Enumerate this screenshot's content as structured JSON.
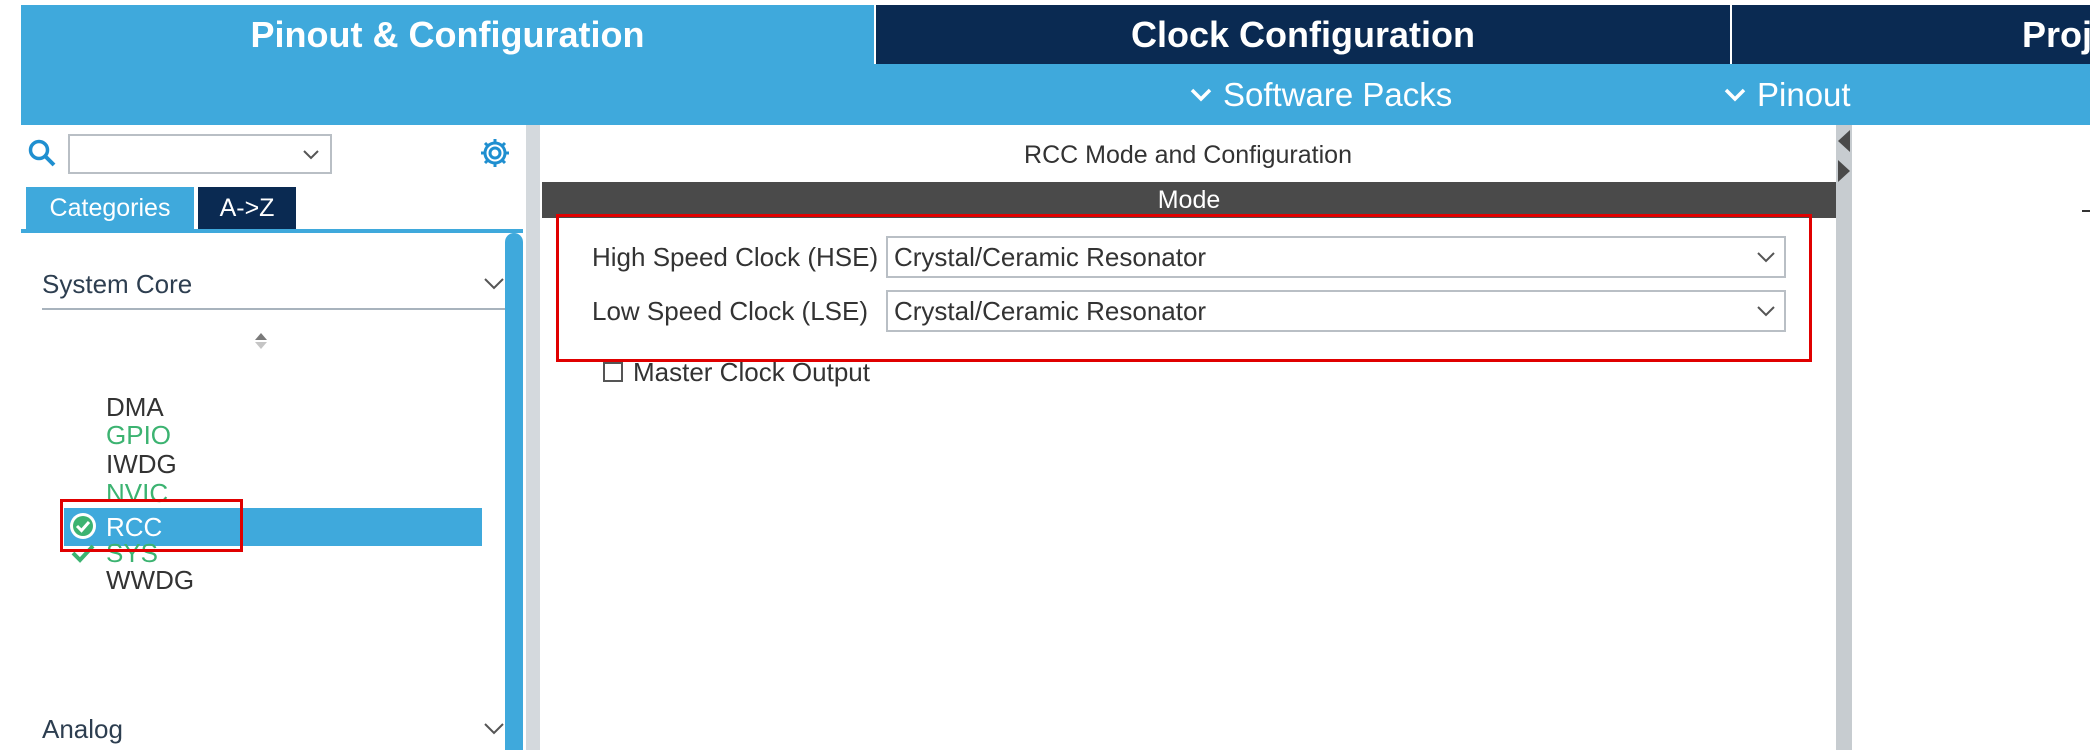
{
  "tabs": [
    {
      "label": "Pinout & Configuration",
      "active": true
    },
    {
      "label": "Clock Configuration",
      "active": false
    },
    {
      "label": "Proje",
      "active": false
    }
  ],
  "submenu": {
    "software_packs": "Software Packs",
    "pinout": "Pinout"
  },
  "left_panel": {
    "search": {
      "value": ""
    },
    "category_tabs": [
      "Categories",
      "A->Z"
    ],
    "groups": {
      "system_core": "System Core",
      "analog": "Analog"
    },
    "items": [
      {
        "label": "DMA",
        "status": "none"
      },
      {
        "label": "GPIO",
        "status": "green"
      },
      {
        "label": "IWDG",
        "status": "none"
      },
      {
        "label": "NVIC",
        "status": "green"
      },
      {
        "label": "RCC",
        "status": "selected-configured"
      },
      {
        "label": "SYS",
        "status": "configured"
      },
      {
        "label": "WWDG",
        "status": "none"
      }
    ]
  },
  "center_panel": {
    "title": "RCC Mode and Configuration",
    "mode_header": "Mode",
    "fields": [
      {
        "label": "High Speed Clock (HSE)",
        "value": "Crystal/Ceramic Resonator"
      },
      {
        "label": "Low Speed Clock (LSE)",
        "value": "Crystal/Ceramic Resonator"
      }
    ],
    "master_clock_output": {
      "label": "Master Clock Output",
      "checked": false
    }
  },
  "colors": {
    "accent_blue": "#3fa9dc",
    "dark_navy": "#0a2a52",
    "status_green": "#3cb371",
    "highlight_red": "#e00000"
  }
}
